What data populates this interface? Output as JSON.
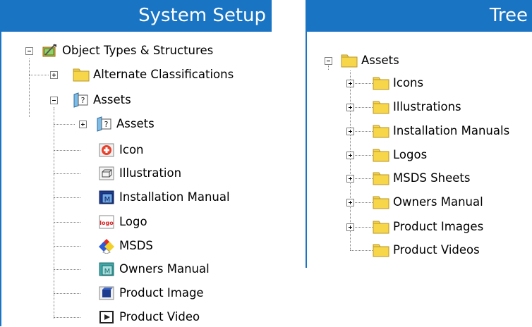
{
  "left_panel": {
    "title": "System Setup",
    "items": [
      {
        "label": "Object Types & Structures",
        "icon": "object-types-icon",
        "expander": "minus"
      },
      {
        "label": "Alternate Classifications",
        "icon": "folder-icon",
        "expander": "plus"
      },
      {
        "label": "Assets",
        "icon": "asset-type-icon",
        "expander": "minus"
      },
      {
        "label": "Assets",
        "icon": "asset-type-icon",
        "expander": "plus"
      },
      {
        "label": "Icon",
        "icon": "icon-asset-icon"
      },
      {
        "label": "Illustration",
        "icon": "illustration-icon"
      },
      {
        "label": "Installation Manual",
        "icon": "installation-manual-icon"
      },
      {
        "label": "Logo",
        "icon": "logo-icon"
      },
      {
        "label": "MSDS",
        "icon": "msds-icon"
      },
      {
        "label": "Owners Manual",
        "icon": "owners-manual-icon"
      },
      {
        "label": "Product Image",
        "icon": "product-image-icon"
      },
      {
        "label": "Product Video",
        "icon": "product-video-icon"
      }
    ]
  },
  "right_panel": {
    "title": "Tree",
    "items": [
      {
        "label": "Assets",
        "icon": "folder-icon",
        "expander": "minus"
      },
      {
        "label": "Icons",
        "icon": "folder-icon",
        "expander": "plus"
      },
      {
        "label": "Illustrations",
        "icon": "folder-icon",
        "expander": "plus"
      },
      {
        "label": "Installation Manuals",
        "icon": "folder-icon",
        "expander": "plus"
      },
      {
        "label": "Logos",
        "icon": "folder-icon",
        "expander": "plus"
      },
      {
        "label": "MSDS Sheets",
        "icon": "folder-icon",
        "expander": "plus"
      },
      {
        "label": "Owners Manual",
        "icon": "folder-icon",
        "expander": "plus"
      },
      {
        "label": "Product Images",
        "icon": "folder-icon",
        "expander": "plus"
      },
      {
        "label": "Product Videos",
        "icon": "folder-icon"
      }
    ]
  },
  "colors": {
    "header": "#1a74c4",
    "folder": "#f7d64a",
    "folder_edge": "#b8962a"
  }
}
